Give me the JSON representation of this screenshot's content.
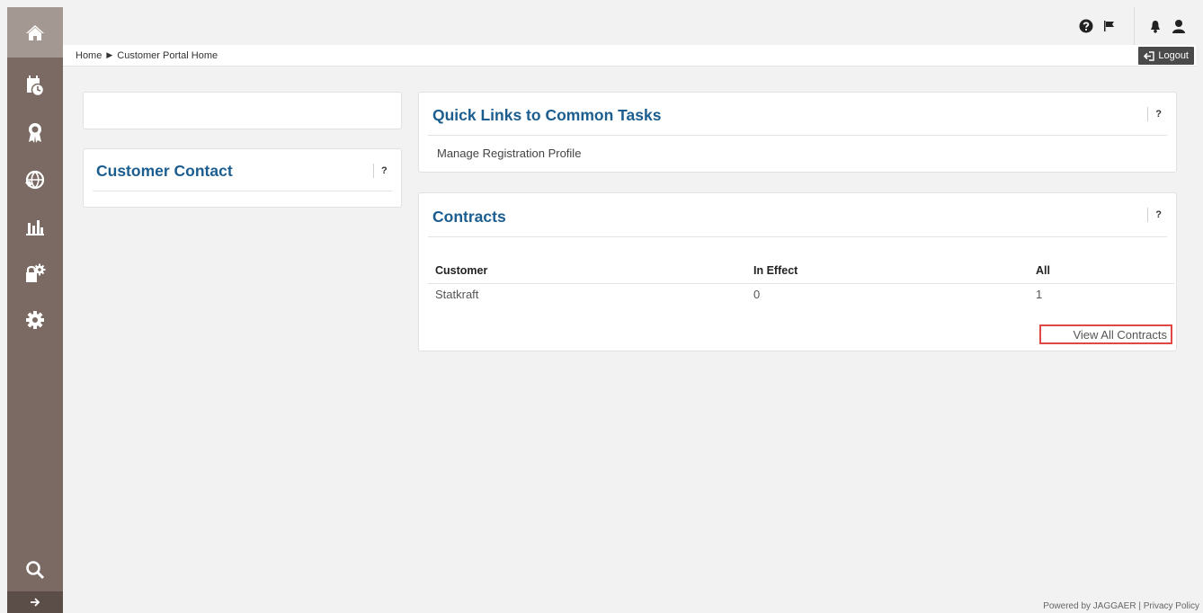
{
  "breadcrumb": {
    "home": "Home",
    "separator": "▶",
    "current": "Customer Portal Home"
  },
  "header": {
    "logout_label": "Logout",
    "icons": [
      "help-icon",
      "flag-icon",
      "bell-icon",
      "user-icon"
    ]
  },
  "sidebar": {
    "items": [
      "home-icon",
      "calendar-clock-icon",
      "award-icon",
      "globe-handshake-icon",
      "bar-chart-icon",
      "lock-settings-icon",
      "gear-icon",
      "search-icon",
      "expand-arrow-icon"
    ]
  },
  "customer_contact": {
    "title": "Customer Contact",
    "help": "?"
  },
  "quick_links": {
    "title": "Quick Links to Common Tasks",
    "help": "?",
    "links": [
      "Manage Registration Profile"
    ]
  },
  "contracts": {
    "title": "Contracts",
    "help": "?",
    "columns": [
      "Customer",
      "In Effect",
      "All"
    ],
    "rows": [
      [
        "Statkraft",
        "0",
        "1"
      ]
    ],
    "view_all": "View All Contracts"
  },
  "footer": {
    "powered_by": "Powered by JAGGAER",
    "separator": "|",
    "privacy": "Privacy Policy"
  },
  "colors": {
    "title_blue": "#1c5d8f",
    "sidebar": "#7a6a63",
    "highlight": "#e04848"
  }
}
